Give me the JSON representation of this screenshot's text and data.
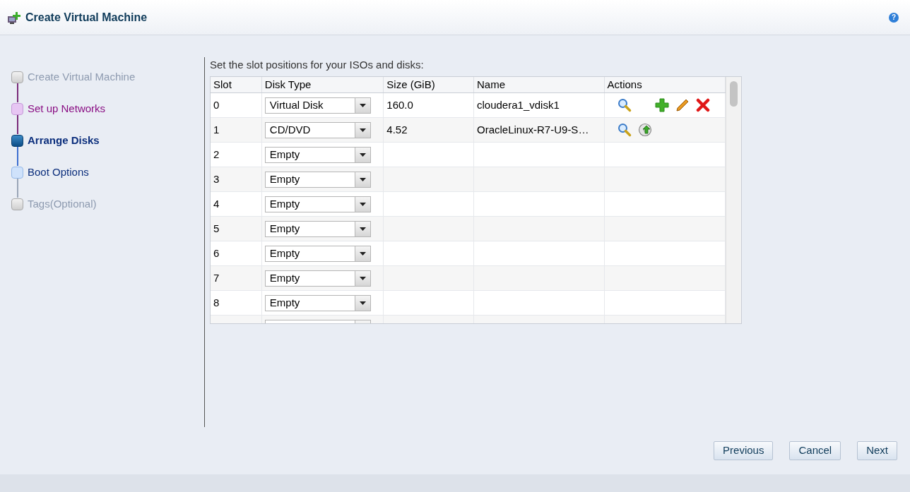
{
  "window": {
    "title": "Create Virtual Machine",
    "help": "?"
  },
  "steps": [
    {
      "label": "Create Virtual Machine",
      "kind": "disabled"
    },
    {
      "label": "Set up Networks",
      "kind": "visited"
    },
    {
      "label": "Arrange Disks",
      "kind": "current"
    },
    {
      "label": "Boot Options",
      "kind": "available"
    },
    {
      "label": "Tags(Optional)",
      "kind": "disabled"
    }
  ],
  "instructions": "Set the slot positions for your ISOs and disks:",
  "table": {
    "columns": [
      "Slot",
      "Disk Type",
      "Size (GiB)",
      "Name",
      "Actions"
    ],
    "rows": [
      {
        "slot": "0",
        "disk_type": "Virtual Disk",
        "size": "160.0",
        "name": "cloudera1_vdisk1",
        "actions": [
          {
            "kind": "view"
          },
          {
            "kind": "add"
          },
          {
            "kind": "edit"
          },
          {
            "kind": "delete"
          }
        ]
      },
      {
        "slot": "1",
        "disk_type": "CD/DVD",
        "size": "4.52",
        "name": "OracleLinux-R7-U9-S…",
        "actions": [
          {
            "kind": "view"
          },
          {
            "kind": "eject"
          }
        ]
      },
      {
        "slot": "2",
        "disk_type": "Empty"
      },
      {
        "slot": "3",
        "disk_type": "Empty"
      },
      {
        "slot": "4",
        "disk_type": "Empty"
      },
      {
        "slot": "5",
        "disk_type": "Empty"
      },
      {
        "slot": "6",
        "disk_type": "Empty"
      },
      {
        "slot": "7",
        "disk_type": "Empty"
      },
      {
        "slot": "8",
        "disk_type": "Empty"
      }
    ]
  },
  "buttons": [
    "Previous",
    "Cancel",
    "Next"
  ]
}
